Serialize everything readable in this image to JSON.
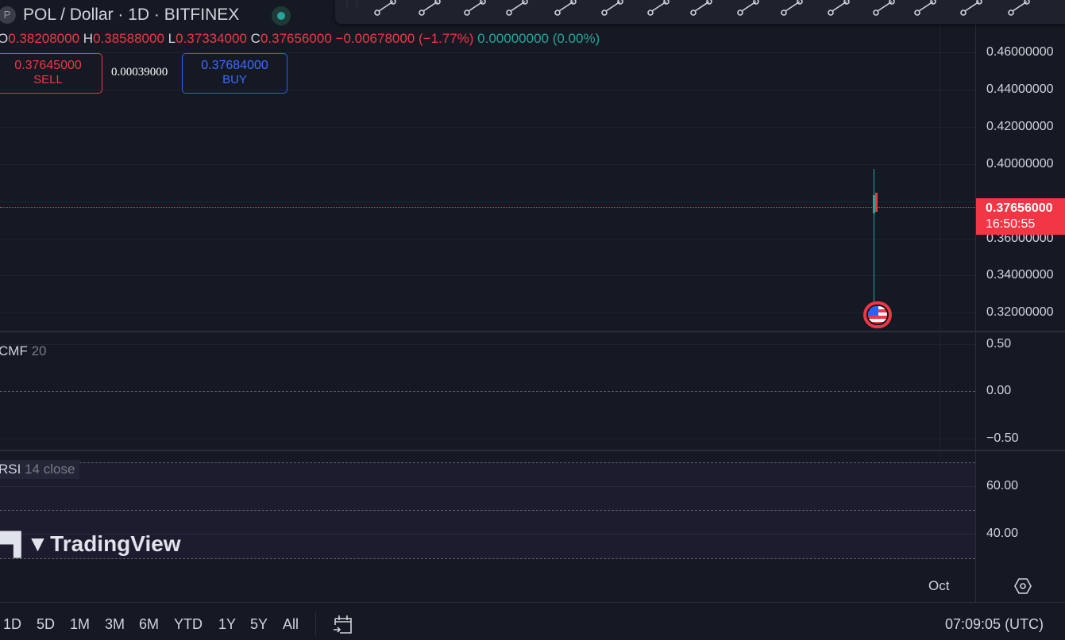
{
  "header": {
    "symbol_icon": "P",
    "title": "POL / Dollar · 1D · BITFINEX",
    "market_status": "open"
  },
  "ohlc": {
    "o_label": "O",
    "o": "0.38208000",
    "h_label": "H",
    "h": "0.38588000",
    "l_label": "L",
    "l": "0.37334000",
    "c_label": "C",
    "c": "0.37656000",
    "change": "−0.00678000 (−1.77%)",
    "volume": "0.00000000 (0.00%)"
  },
  "trade": {
    "sell_price": "0.37645000",
    "sell_label": "SELL",
    "spread": "0.00039000",
    "buy_price": "0.37684000",
    "buy_label": "BUY"
  },
  "toolbar": {
    "tools": [
      "trend-line-tool",
      "horizontal-line-tool",
      "parallel-channel-tool",
      "ray-tool",
      "candles-tool",
      "vertical-line-tool",
      "rectangle-tool",
      "pitchfork-tool",
      "circle-tool",
      "fib-channel-tool",
      "extended-line-tool",
      "anchor-line-tool",
      "info-line-tool",
      "triangle-tool",
      "pattern-tool"
    ]
  },
  "price_axis": {
    "ticks": [
      "0.46000000",
      "0.44000000",
      "0.42000000",
      "0.40000000",
      "0.36000000",
      "0.34000000",
      "0.32000000"
    ],
    "current_price": "0.37656000",
    "countdown": "16:50:55"
  },
  "cmf": {
    "label": "CMF",
    "param": "20",
    "ticks": [
      "0.50",
      "0.00",
      "−0.50"
    ]
  },
  "rsi": {
    "label": "RSI",
    "params": "14 close",
    "ticks": [
      "60.00",
      "40.00"
    ]
  },
  "logo": "TradingView",
  "time_axis": {
    "label": "Oct"
  },
  "colors": {
    "up": "#26a69a",
    "down": "#f23645",
    "buy": "#2962ff"
  },
  "bottom_bar": {
    "ranges": [
      "1D",
      "5D",
      "1M",
      "3M",
      "6M",
      "YTD",
      "1Y",
      "5Y",
      "All"
    ],
    "clock": "07:09:05 (UTC)"
  }
}
